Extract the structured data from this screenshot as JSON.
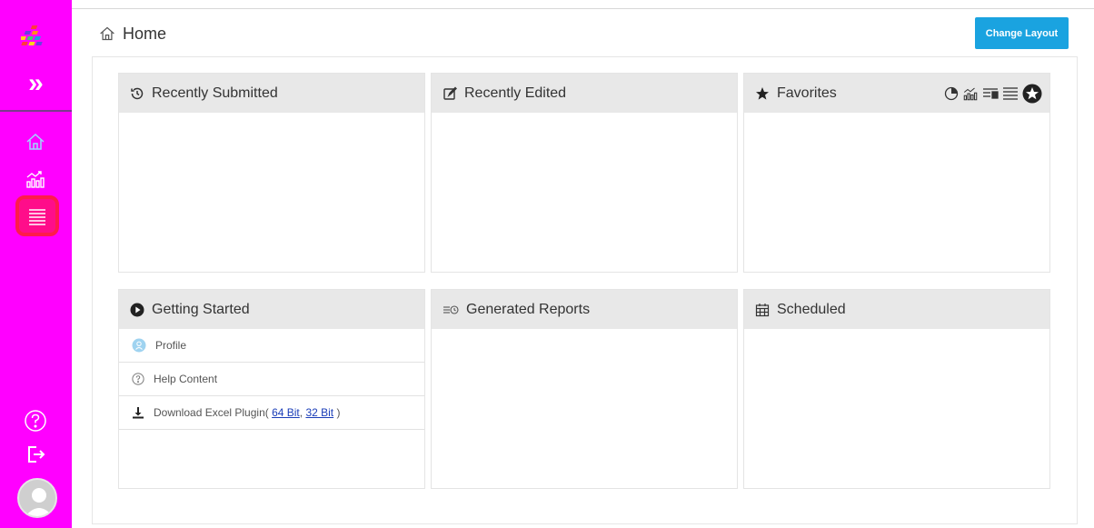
{
  "header": {
    "title": "Home",
    "change_layout_label": "Change Layout"
  },
  "sidebar": {
    "items": [
      {
        "name": "home",
        "icon": "home-icon"
      },
      {
        "name": "analytics",
        "icon": "analytics-chart-icon"
      },
      {
        "name": "reports",
        "icon": "list-lines-icon",
        "active": true
      },
      {
        "name": "help",
        "icon": "help-circle-icon"
      },
      {
        "name": "logout",
        "icon": "logout-icon"
      },
      {
        "name": "profile",
        "icon": "avatar-icon"
      }
    ],
    "expand_label": "»"
  },
  "panels": {
    "recently_submitted": {
      "title": "Recently Submitted",
      "icon": "history-icon"
    },
    "recently_edited": {
      "title": "Recently Edited",
      "icon": "edit-icon"
    },
    "favorites": {
      "title": "Favorites",
      "icon": "star-icon",
      "tools": [
        "pie-chart-icon",
        "analytics-chart-icon",
        "list-bars-icon",
        "list-lines-icon",
        "star-circle-icon"
      ]
    },
    "getting_started": {
      "title": "Getting Started",
      "icon": "play-circle-icon",
      "items": {
        "profile": "Profile",
        "help_content": "Help Content",
        "download_prefix": "Download Excel Plugin(",
        "link_64": "64 Bit",
        "separator": ",",
        "link_32": "32 Bit",
        "download_suffix": ")"
      }
    },
    "generated_reports": {
      "title": "Generated Reports",
      "icon": "report-clock-icon"
    },
    "scheduled": {
      "title": "Scheduled",
      "icon": "calendar-icon"
    }
  },
  "colors": {
    "sidebar": "#ff00ff",
    "active_item": "#ff0d8a",
    "active_outline": "#ff1a4b",
    "button": "#1aa3e0",
    "panel_header": "#e8e8e8",
    "link": "#1a3db8"
  }
}
